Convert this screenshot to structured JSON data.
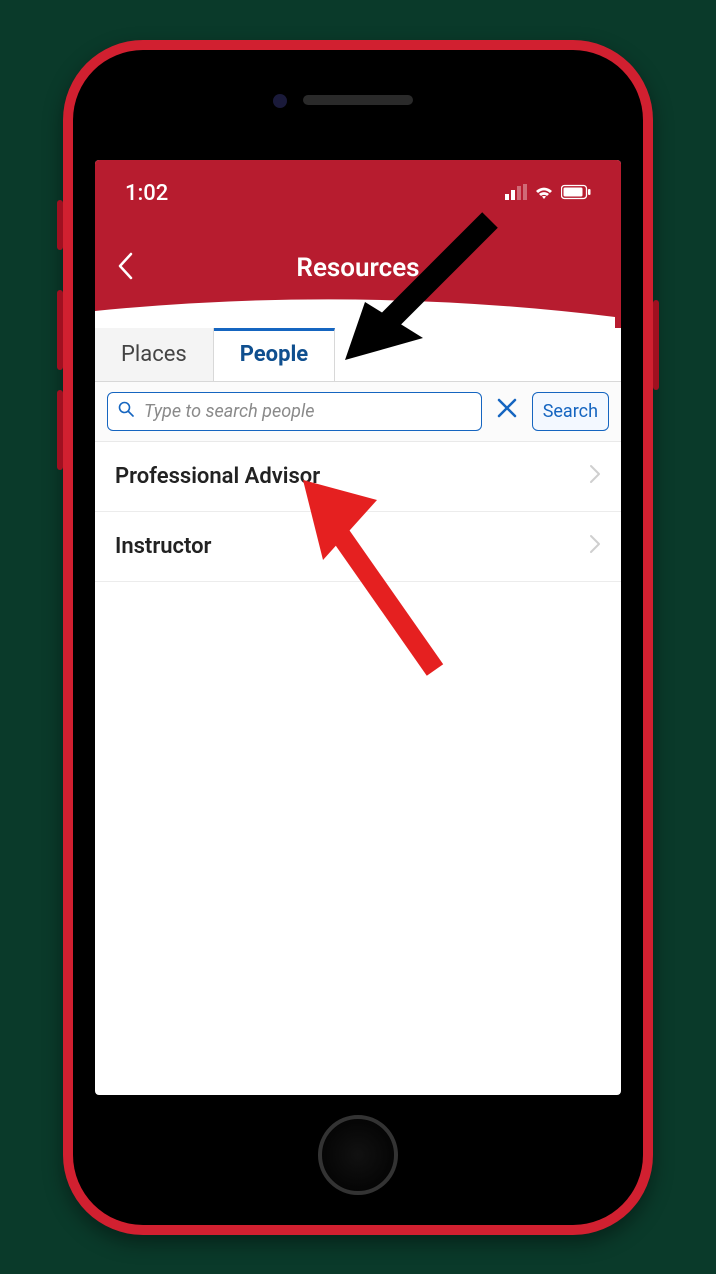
{
  "status": {
    "time": "1:02"
  },
  "nav": {
    "title": "Resources"
  },
  "tabs": {
    "places_label": "Places",
    "people_label": "People"
  },
  "search": {
    "placeholder": "Type to search people",
    "button_label": "Search"
  },
  "list": {
    "items": [
      {
        "label": "Professional Advisor"
      },
      {
        "label": "Instructor"
      }
    ]
  }
}
